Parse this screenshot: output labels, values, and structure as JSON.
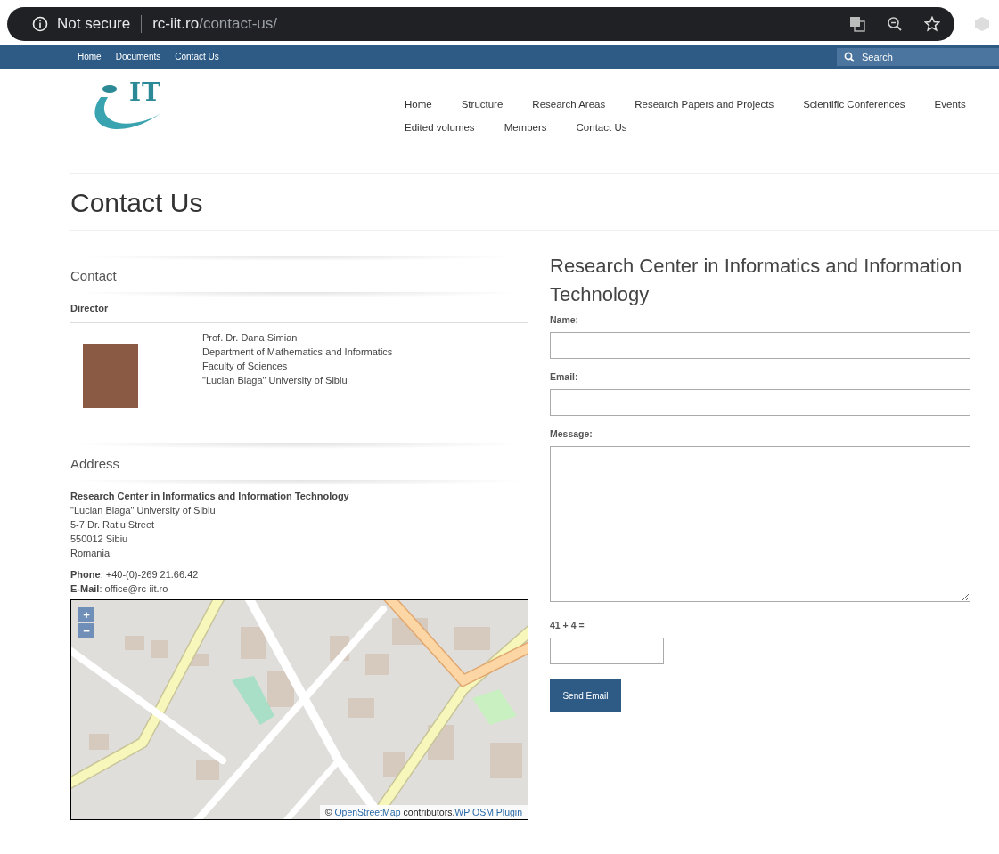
{
  "browser": {
    "security": "Not secure",
    "url_host": "rc-iit.ro",
    "url_path": "/contact-us/"
  },
  "top_bar": {
    "links": [
      "Home",
      "Documents",
      "Contact Us"
    ],
    "search": {
      "placeholder": "Search"
    }
  },
  "logo": {
    "text": "IT"
  },
  "nav": [
    "Home",
    "Structure",
    "Research Areas",
    "Research Papers and Projects",
    "Scientific Conferences",
    "Events",
    "Edited volumes",
    "Members",
    "Contact Us"
  ],
  "page_title": "Contact Us",
  "contact": {
    "heading": "Contact",
    "director_label": "Director",
    "director_lines": [
      "Prof. Dr. Dana Simian",
      "Department of Mathematics and Informatics",
      "Faculty of Sciences",
      "\"Lucian Blaga\" University of Sibiu"
    ]
  },
  "address": {
    "heading": "Address",
    "org": "Research Center in Informatics and Information Technology",
    "lines": [
      "\"Lucian Blaga\" University of Sibiu",
      "5-7 Dr. Ratiu Street",
      "550012 Sibiu",
      "Romania"
    ],
    "contacts": [
      "**Phone**: +40-(0)-269 21.66.42",
      "**E-Mail**: office@rc-iit.ro"
    ]
  },
  "map": {
    "zoom_in": "+",
    "zoom_out": "−",
    "attribution": {
      "prefix": "©",
      "link": "OpenStreetMap",
      "middle": "contributors.",
      "plugin": "WP OSM Plugin"
    }
  },
  "form": {
    "title": "Research Center in Informatics and Information Technology",
    "fields": [
      {
        "label": "Name:",
        "kind": "input"
      },
      {
        "label": "Email:",
        "kind": "input"
      },
      {
        "label": "Message:",
        "kind": "textarea"
      },
      {
        "label": "41 + 4 =",
        "kind": "captcha"
      }
    ],
    "submit": "Send Email"
  }
}
